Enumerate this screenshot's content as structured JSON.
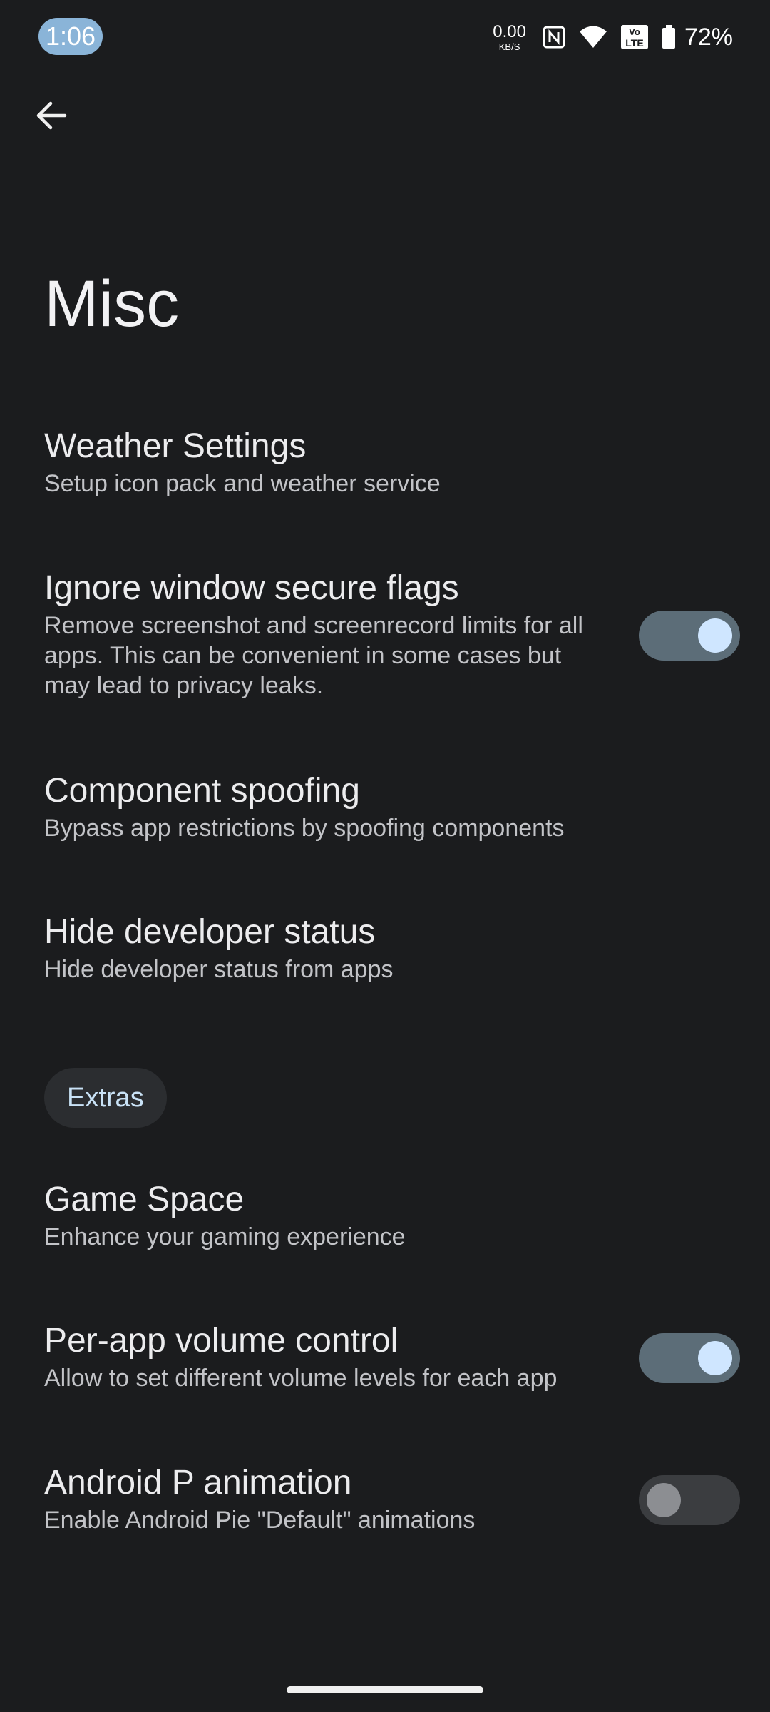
{
  "status_bar": {
    "time": "1:06",
    "net_speed_value": "0.00",
    "net_speed_unit": "KB/S",
    "volte_label_top": "Vo",
    "volte_label_bottom": "LTE",
    "battery": "72%",
    "icons": [
      "nfc-icon",
      "wifi-icon",
      "volte-icon",
      "battery-icon"
    ]
  },
  "header": {
    "back_icon": "arrow-back-icon",
    "title": "Misc"
  },
  "items": [
    {
      "title": "Weather Settings",
      "summary": "Setup icon pack and weather service"
    },
    {
      "title": "Ignore window secure flags",
      "summary": "Remove screenshot and screenrecord limits for all apps. This can be convenient in some cases but may lead to privacy leaks.",
      "toggle": "on"
    },
    {
      "title": "Component spoofing",
      "summary": "Bypass app restrictions by spoofing components"
    },
    {
      "title": "Hide developer status",
      "summary": "Hide developer status from apps"
    }
  ],
  "section": {
    "label": "Extras"
  },
  "extras": [
    {
      "title": "Game Space",
      "summary": "Enhance your gaming experience"
    },
    {
      "title": "Per-app volume control",
      "summary": "Allow to set different volume levels for each app",
      "toggle": "on"
    },
    {
      "title": "Android P animation",
      "summary": "Enable Android Pie \"Default\" animations",
      "toggle": "off"
    }
  ],
  "colors": {
    "background": "#1b1c1e",
    "toggle_on_track": "#5c6d78",
    "toggle_on_knob": "#cfe6ff",
    "toggle_off_track": "#3b3d40",
    "accent_chip_text": "#c9e2f6",
    "time_pill": "#8ab4d8"
  }
}
